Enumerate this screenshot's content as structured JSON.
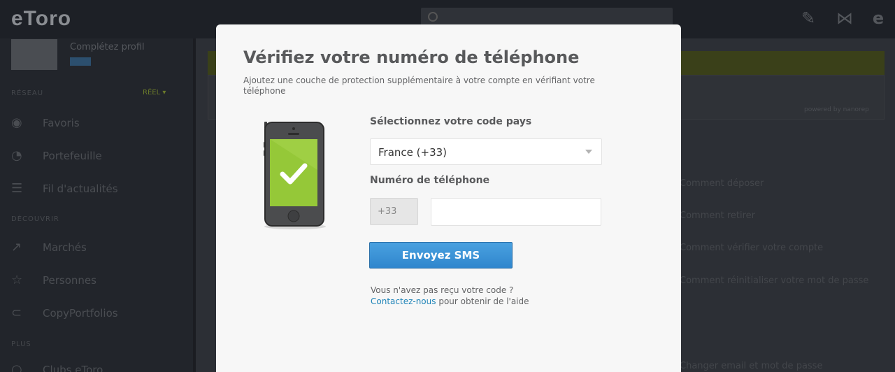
{
  "app": {
    "logo": "eToro",
    "sidebar": {
      "profile_name": "Complétez profil",
      "section_main": "RÉSEAU",
      "account_mode": "RÉEL ▾",
      "section_discover": "DÉCOUVRIR",
      "section_more": "PLUS",
      "items": [
        {
          "label": "Favoris"
        },
        {
          "label": "Portefeuille"
        },
        {
          "label": "Fil d'actualités"
        },
        {
          "label": "Marchés"
        },
        {
          "label": "Personnes"
        },
        {
          "label": "CopyPortfolios"
        },
        {
          "label": "Clubs eToro"
        }
      ]
    },
    "content": {
      "powered_by": "powered by nanorep",
      "help_links": [
        "Comment déposer",
        "Comment retirer",
        "Comment vérifier votre compte",
        "Comment réinitialiser votre mot de passe",
        "Changer email et mot de passe"
      ]
    }
  },
  "modal": {
    "title": "Vérifiez votre numéro de téléphone",
    "subtitle": "Ajoutez une couche de protection supplémentaire à votre compte en vérifiant votre téléphone",
    "country_label": "Sélectionnez votre code pays",
    "country_value": "France (+33)",
    "phone_label": "Numéro de téléphone",
    "phone_prefix": "+33",
    "phone_value": "",
    "send_button": "Envoyez SMS",
    "help_question": "Vous n'avez pas reçu votre code ?",
    "contact_link": "Contactez-nous",
    "contact_suffix": " pour obtenir de l'aide"
  },
  "colors": {
    "accent_blue": "#3190d6",
    "link": "#1f84b8",
    "phone_screen": "#95c838"
  }
}
